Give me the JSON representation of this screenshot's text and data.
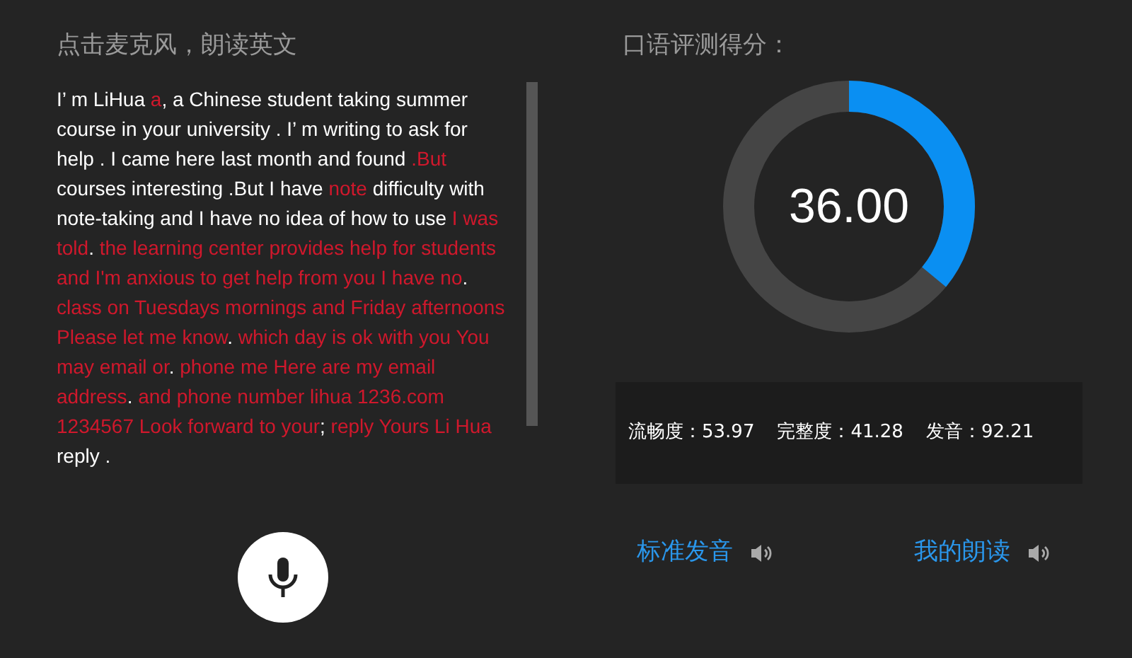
{
  "instruction": "点击麦克风，朗读英文",
  "passage": [
    {
      "text": "I’ m LiHua ",
      "error": false
    },
    {
      "text": "a",
      "error": true
    },
    {
      "text": ", a Chinese student taking summer course in your university . I’ m writing to ask for help . I came here last month and found ",
      "error": false
    },
    {
      "text": ".But",
      "error": true
    },
    {
      "text": " courses interesting .But I have ",
      "error": false
    },
    {
      "text": "note",
      "error": true
    },
    {
      "text": " difficulty with note-taking and I have no idea of how to use ",
      "error": false
    },
    {
      "text": "I was told",
      "error": true
    },
    {
      "text": ". ",
      "error": false
    },
    {
      "text": "the learning center provides help for students and I'm anxious to get help from you I have no",
      "error": true
    },
    {
      "text": ". ",
      "error": false
    },
    {
      "text": "class on Tuesdays mornings and Friday afternoons Please let me know",
      "error": true
    },
    {
      "text": ". ",
      "error": false
    },
    {
      "text": "which day is ok with you You may email or",
      "error": true
    },
    {
      "text": ". ",
      "error": false
    },
    {
      "text": "phone me Here are my email address",
      "error": true
    },
    {
      "text": ". ",
      "error": false
    },
    {
      "text": "and phone number lihua 1236.com 1234567 Look forward to your",
      "error": true
    },
    {
      "text": "; ",
      "error": false
    },
    {
      "text": "reply Yours Li Hua",
      "error": true
    },
    {
      "text": " reply .",
      "error": false
    }
  ],
  "score_title": "口语评测得分：",
  "score": {
    "text": "36.00",
    "level": 0.36
  },
  "metrics": [
    {
      "label": "流畅度：",
      "value": "53.97"
    },
    {
      "label": "完整度：",
      "value": "41.28"
    },
    {
      "label": "发音：",
      "value": "92.21"
    }
  ],
  "audio_links": [
    {
      "label": "标准发音"
    },
    {
      "label": "我的朗读"
    }
  ]
}
